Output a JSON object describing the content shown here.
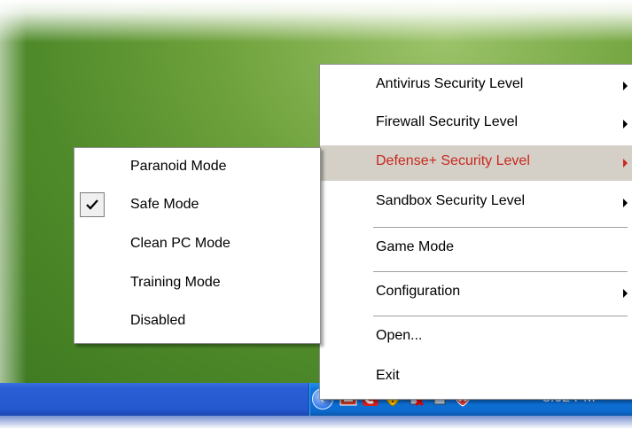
{
  "main_menu": {
    "items": [
      {
        "label": "Antivirus Security Level",
        "submenu": true
      },
      {
        "label": "Firewall Security Level",
        "submenu": true
      },
      {
        "label": "Defense+ Security Level",
        "submenu": true,
        "highlighted": true
      },
      {
        "label": "Sandbox Security Level",
        "submenu": true
      },
      {
        "label": "Game Mode",
        "submenu": false
      },
      {
        "label": "Configuration",
        "submenu": true
      },
      {
        "label": "Open...",
        "submenu": false
      },
      {
        "label": "Exit",
        "submenu": false
      }
    ]
  },
  "defense_submenu": {
    "items": [
      {
        "label": "Paranoid Mode",
        "checked": false
      },
      {
        "label": "Safe Mode",
        "checked": true
      },
      {
        "label": "Clean PC Mode",
        "checked": false
      },
      {
        "label": "Training Mode",
        "checked": false
      },
      {
        "label": "Disabled",
        "checked": false
      }
    ]
  },
  "taskbar": {
    "clock": "3:02 PM",
    "tray_icons": [
      "show-hidden-icons-arrow",
      "network-share-icon",
      "comodo-icon",
      "shield-alert-icon",
      "network-disconnected-icon",
      "network-icon",
      "security-shield-icon"
    ]
  },
  "colors": {
    "highlight_text": "#c8281d",
    "highlight_bg": "#d4d0c8",
    "taskbar": "#2458cf",
    "tray": "#0c6bcf"
  }
}
